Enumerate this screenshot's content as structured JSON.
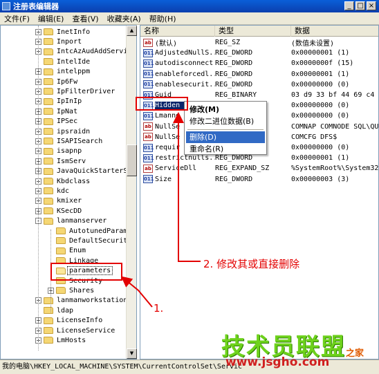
{
  "window": {
    "title": "注册表编辑器"
  },
  "window_buttons": {
    "minimize": "_",
    "maximize": "□",
    "close": "×"
  },
  "menubar": [
    "文件(F)",
    "编辑(E)",
    "查看(V)",
    "收藏夹(A)",
    "帮助(H)"
  ],
  "tree": {
    "items": [
      {
        "label": "InetInfo",
        "expander": "+"
      },
      {
        "label": "Inport",
        "expander": "+"
      },
      {
        "label": "IntcAzAudAddServic",
        "expander": "+"
      },
      {
        "label": "IntelIde",
        "expander": ""
      },
      {
        "label": "intelppm",
        "expander": "+"
      },
      {
        "label": "Ip6Fw",
        "expander": "+"
      },
      {
        "label": "IpFilterDriver",
        "expander": "+"
      },
      {
        "label": "IpInIp",
        "expander": "+"
      },
      {
        "label": "IpNat",
        "expander": "+"
      },
      {
        "label": "IPSec",
        "expander": "+"
      },
      {
        "label": "ipsraidn",
        "expander": "+"
      },
      {
        "label": "ISAPISearch",
        "expander": "+"
      },
      {
        "label": "isapnp",
        "expander": "+"
      },
      {
        "label": "IsmServ",
        "expander": "+"
      },
      {
        "label": "JavaQuickStarterSe",
        "expander": "+"
      },
      {
        "label": "Kbdclass",
        "expander": "+"
      },
      {
        "label": "kdc",
        "expander": "+"
      },
      {
        "label": "kmixer",
        "expander": "+"
      },
      {
        "label": "KSecDD",
        "expander": "+"
      },
      {
        "label": "lanmanserver",
        "expander": "-"
      },
      {
        "label": "AutotunedParame",
        "expander": ""
      },
      {
        "label": "DefaultSecurity",
        "expander": ""
      },
      {
        "label": "Enum",
        "expander": ""
      },
      {
        "label": "Linkage",
        "expander": ""
      },
      {
        "label": "parameters",
        "expander": ""
      },
      {
        "label": "Security",
        "expander": ""
      },
      {
        "label": "Shares",
        "expander": "+"
      },
      {
        "label": "lanmanworkstation",
        "expander": "+"
      },
      {
        "label": "ldap",
        "expander": ""
      },
      {
        "label": "LicenseInfo",
        "expander": "+"
      },
      {
        "label": "LicenseService",
        "expander": "+"
      },
      {
        "label": "LmHosts",
        "expander": "+"
      }
    ]
  },
  "list": {
    "columns": [
      "名称",
      "类型",
      "数据"
    ],
    "rows": [
      {
        "icon": "ab",
        "name": "(默认)",
        "type": "REG_SZ",
        "data": "(数值未设置)"
      },
      {
        "icon": "bin",
        "name": "AdjustedNullS...",
        "type": "REG_DWORD",
        "data": "0x00000001 (1)"
      },
      {
        "icon": "bin",
        "name": "autodisconnect",
        "type": "REG_DWORD",
        "data": "0x0000000f (15)"
      },
      {
        "icon": "bin",
        "name": "enableforcedl...",
        "type": "REG_DWORD",
        "data": "0x00000001 (1)"
      },
      {
        "icon": "bin",
        "name": "enablesecurit...",
        "type": "REG_DWORD",
        "data": "0x00000000 (0)"
      },
      {
        "icon": "bin",
        "name": "Guid",
        "type": "REG_BINARY",
        "data": "03 d9 33 bf 44 69 c4 4"
      },
      {
        "icon": "bin",
        "name": "Hidden",
        "type": "",
        "data": "0x00000000 (0)"
      },
      {
        "icon": "bin",
        "name": "Lmanno",
        "type": "",
        "data": "0x00000000 (0)"
      },
      {
        "icon": "ab",
        "name": "NullSe",
        "type": "",
        "data": "COMNAP COMNODE SQL\\QUE"
      },
      {
        "icon": "ab",
        "name": "NullSe",
        "type": "",
        "data": "COMCFG DFS$"
      },
      {
        "icon": "bin",
        "name": "requir",
        "type": "",
        "data": "0x00000000 (0)"
      },
      {
        "icon": "bin",
        "name": "restrictnulls...",
        "type": "REG_DWORD",
        "data": "0x00000001 (1)"
      },
      {
        "icon": "ab",
        "name": "ServiceDll",
        "type": "REG_EXPAND_SZ",
        "data": "%SystemRoot%\\System32\\"
      },
      {
        "icon": "bin",
        "name": "Size",
        "type": "REG_DWORD",
        "data": "0x00000003 (3)"
      }
    ]
  },
  "context_menu": {
    "items": [
      "修改(M)",
      "修改二进位数据(B)",
      "删除(D)",
      "重命名(R)"
    ]
  },
  "statusbar": {
    "path": "我的电脑\\HKEY_LOCAL_MACHINE\\SYSTEM\\CurrentControlSet\\Servic"
  },
  "annotations": {
    "step1": "1.",
    "step2": "2. 修改其或直接删除",
    "color": "#e30000"
  },
  "watermark": {
    "logo": "技术员联盟",
    "sub": "之家",
    "url": "www.jsgho.com",
    "tail": "10.COM"
  }
}
